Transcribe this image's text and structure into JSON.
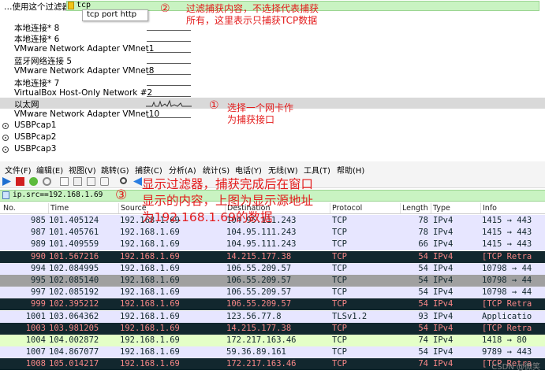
{
  "capture_filter": {
    "label": "…使用这个过滤器:",
    "value": "tcp",
    "suggestion": "tcp port http"
  },
  "interfaces": [
    {
      "name": "本地连接* 8",
      "graph": "flat"
    },
    {
      "name": "本地连接* 6",
      "graph": "flat"
    },
    {
      "name": "VMware Network Adapter VMnet1",
      "graph": "flat"
    },
    {
      "name": "蓝牙网络连接 5",
      "graph": "flat"
    },
    {
      "name": "VMware Network Adapter VMnet8",
      "graph": "flat"
    },
    {
      "name": "本地连接* 7",
      "graph": "flat"
    },
    {
      "name": "VirtualBox Host-Only Network #2",
      "graph": "flat"
    },
    {
      "name": "以太网",
      "graph": "spiky",
      "selected": true
    },
    {
      "name": "VMware Network Adapter VMnet10",
      "graph": "flat"
    },
    {
      "name": "USBPcap1",
      "graph": "none",
      "icon": "radio-icon"
    },
    {
      "name": "USBPcap2",
      "graph": "none",
      "icon": "radio-icon"
    },
    {
      "name": "USBPcap3",
      "graph": "none",
      "icon": "radio-icon"
    }
  ],
  "annotations": {
    "circle2": "②",
    "note2_line1": "过滤捕获内容，不选择代表捕获",
    "note2_line2": "所有，这里表示只捕获TCP数据",
    "circle1": "①",
    "note1_line1": "选择一个网卡作",
    "note1_line2": "为捕获接口",
    "circle3": "③",
    "note3_line1": "显示过滤器，捕获完成后在窗口",
    "note3_line2": "显示的内容，上图为显示源地址",
    "note3_line3": "为192.168.1.69的数据"
  },
  "menu": [
    "文件(F)",
    "编辑(E)",
    "视图(V)",
    "跳转(G)",
    "捕获(C)",
    "分析(A)",
    "统计(S)",
    "电话(Y)",
    "无线(W)",
    "工具(T)",
    "帮助(H)"
  ],
  "display_filter": {
    "value": "ip.src==192.168.1.69"
  },
  "columns": [
    "No.",
    "Time",
    "Source",
    "Destination",
    "Protocol",
    "Length",
    "Type",
    "Info"
  ],
  "packets": [
    {
      "no": "985",
      "time": "101.405124",
      "src": "192.168.1.69",
      "dst": "104.95.111.243",
      "proto": "TCP",
      "len": "78",
      "type": "IPv4",
      "info": "1415 → 443",
      "bg": "#e7e6ff",
      "fg": "#12272e"
    },
    {
      "no": "987",
      "time": "101.405761",
      "src": "192.168.1.69",
      "dst": "104.95.111.243",
      "proto": "TCP",
      "len": "78",
      "type": "IPv4",
      "info": "1415 → 443",
      "bg": "#e7e6ff",
      "fg": "#12272e"
    },
    {
      "no": "989",
      "time": "101.409559",
      "src": "192.168.1.69",
      "dst": "104.95.111.243",
      "proto": "TCP",
      "len": "66",
      "type": "IPv4",
      "info": "1415 → 443",
      "bg": "#e7e6ff",
      "fg": "#12272e"
    },
    {
      "no": "990",
      "time": "101.567216",
      "src": "192.168.1.69",
      "dst": "14.215.177.38",
      "proto": "TCP",
      "len": "54",
      "type": "IPv4",
      "info": "[TCP Retra",
      "bg": "#12272e",
      "fg": "#f78787"
    },
    {
      "no": "994",
      "time": "102.084995",
      "src": "192.168.1.69",
      "dst": "106.55.209.57",
      "proto": "TCP",
      "len": "54",
      "type": "IPv4",
      "info": "10798 → 44",
      "bg": "#e7e6ff",
      "fg": "#12272e"
    },
    {
      "no": "995",
      "time": "102.085140",
      "src": "192.168.1.69",
      "dst": "106.55.209.57",
      "proto": "TCP",
      "len": "54",
      "type": "IPv4",
      "info": "10798 → 44",
      "bg": "#a0a0a0",
      "fg": "#12272e"
    },
    {
      "no": "997",
      "time": "102.085192",
      "src": "192.168.1.69",
      "dst": "106.55.209.57",
      "proto": "TCP",
      "len": "54",
      "type": "IPv4",
      "info": "10798 → 44",
      "bg": "#e7e6ff",
      "fg": "#12272e"
    },
    {
      "no": "999",
      "time": "102.395212",
      "src": "192.168.1.69",
      "dst": "106.55.209.57",
      "proto": "TCP",
      "len": "54",
      "type": "IPv4",
      "info": "[TCP Retra",
      "bg": "#12272e",
      "fg": "#f78787"
    },
    {
      "no": "1001",
      "time": "103.064362",
      "src": "192.168.1.69",
      "dst": "123.56.77.8",
      "proto": "TLSv1.2",
      "len": "93",
      "type": "IPv4",
      "info": "Applicatio",
      "bg": "#e7e6ff",
      "fg": "#12272e"
    },
    {
      "no": "1003",
      "time": "103.981205",
      "src": "192.168.1.69",
      "dst": "14.215.177.38",
      "proto": "TCP",
      "len": "54",
      "type": "IPv4",
      "info": "[TCP Retra",
      "bg": "#12272e",
      "fg": "#f78787"
    },
    {
      "no": "1004",
      "time": "104.002872",
      "src": "192.168.1.69",
      "dst": "172.217.163.46",
      "proto": "TCP",
      "len": "74",
      "type": "IPv4",
      "info": "1418 → 80",
      "bg": "#e4ffc7",
      "fg": "#12272e"
    },
    {
      "no": "1007",
      "time": "104.867077",
      "src": "192.168.1.69",
      "dst": "59.36.89.161",
      "proto": "TCP",
      "len": "54",
      "type": "IPv4",
      "info": "9789 → 443",
      "bg": "#e7e6ff",
      "fg": "#12272e"
    },
    {
      "no": "1008",
      "time": "105.014217",
      "src": "192.168.1.69",
      "dst": "172.217.163.46",
      "proto": "TCP",
      "len": "74",
      "type": "IPv4",
      "info": "[TCP Retra",
      "bg": "#12272e",
      "fg": "#f78787"
    }
  ],
  "watermark": "CSDN @微笑"
}
